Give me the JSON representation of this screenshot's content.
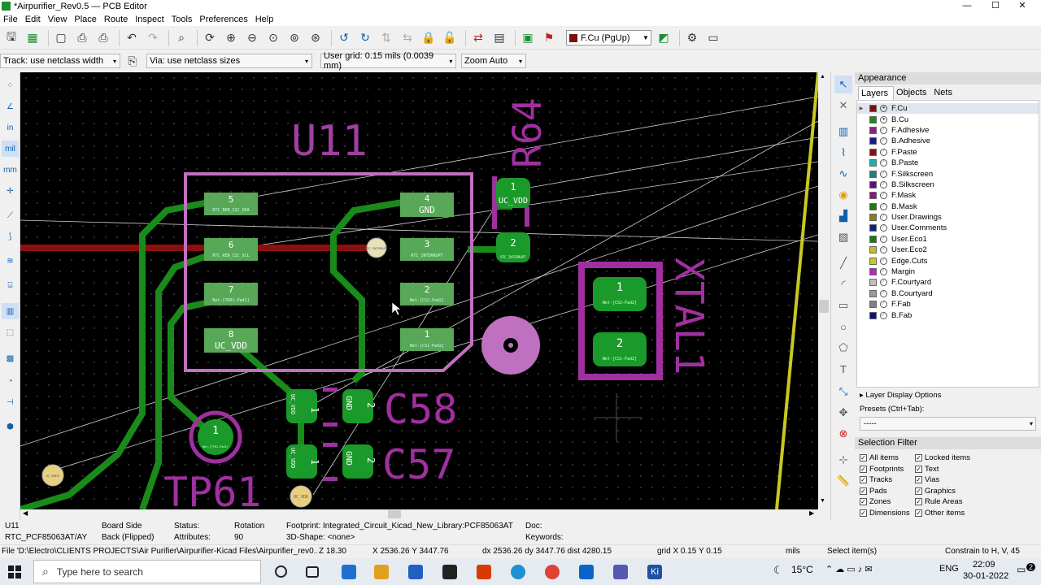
{
  "window": {
    "title": "*Airpurifier_Rev0.5 — PCB Editor",
    "minimize": "—",
    "maximize": "☐",
    "close": "✕"
  },
  "menu": [
    "File",
    "Edit",
    "View",
    "Place",
    "Route",
    "Inspect",
    "Tools",
    "Preferences",
    "Help"
  ],
  "toolbar": {
    "layer_selector": "F.Cu (PgUp)",
    "layer_color": "#7a1010"
  },
  "options": {
    "track": "Track: use netclass width",
    "via": "Via: use netclass sizes",
    "grid": "User grid: 0.15 mils (0.0039 mm)",
    "zoom": "Zoom Auto"
  },
  "canvas": {
    "u11_ref": "U11",
    "r64_ref": "R64",
    "xtal1_ref": "XTAL1",
    "c58_ref": "C58",
    "c57_ref": "C57",
    "tp61_ref": "TP61",
    "u11_pads": [
      {
        "num": "5",
        "net": "RTC_REN_I2C_SDA"
      },
      {
        "num": "6",
        "net": "RTC_REN_I2C_SCL"
      },
      {
        "num": "7",
        "net": "Net-[TR01-Pad1]"
      },
      {
        "num": "8",
        "net": "UC_VDD"
      },
      {
        "num": "4",
        "net": "GND"
      },
      {
        "num": "3",
        "net": "RTC_INTERRUPT"
      },
      {
        "num": "2",
        "net": "Net-[CS2-Pad2]"
      },
      {
        "num": "1",
        "net": "Net-[CS1-Pad2]"
      }
    ],
    "r64_pads": [
      {
        "num": "1",
        "net": "UC_VDD"
      },
      {
        "num": "2",
        "net": "RTC_INTERRUPT"
      }
    ],
    "xtal_pads": [
      {
        "num": "1",
        "net": "Net-[CS2-Pad2]"
      },
      {
        "num": "2",
        "net": "Net-[CS1-Pad2]"
      }
    ],
    "c58_pads": [
      {
        "num": "1",
        "net": "UC_VDD"
      },
      {
        "num": "2",
        "net": "GND"
      }
    ],
    "c57_pads": [
      {
        "num": "1",
        "net": "UC_VDD"
      },
      {
        "num": "2",
        "net": "GND"
      }
    ],
    "tp61_pad": {
      "num": "1",
      "net": "Net-[TP61-Pad1]"
    },
    "via_labels": [
      "RTC_INTERRUPT",
      "UC_SENSE",
      "UC_VDD"
    ]
  },
  "appearance": {
    "title": "Appearance",
    "tabs": [
      "Layers",
      "Objects",
      "Nets"
    ],
    "layers": [
      {
        "name": "F.Cu",
        "color": "#7a1010"
      },
      {
        "name": "B.Cu",
        "color": "#1a8a1a"
      },
      {
        "name": "F.Adhesive",
        "color": "#8a2080"
      },
      {
        "name": "B.Adhesive",
        "color": "#1a1a90"
      },
      {
        "name": "F.Paste",
        "color": "#8a1010"
      },
      {
        "name": "B.Paste",
        "color": "#20b0b0"
      },
      {
        "name": "F.Silkscreen",
        "color": "#208080"
      },
      {
        "name": "B.Silkscreen",
        "color": "#5a1080"
      },
      {
        "name": "F.Mask",
        "color": "#8a1880"
      },
      {
        "name": "B.Mask",
        "color": "#1a7a1a"
      },
      {
        "name": "User.Drawings",
        "color": "#808020"
      },
      {
        "name": "User.Comments",
        "color": "#102080"
      },
      {
        "name": "User.Eco1",
        "color": "#108010"
      },
      {
        "name": "User.Eco2",
        "color": "#c0c020"
      },
      {
        "name": "Edge.Cuts",
        "color": "#c8c820"
      },
      {
        "name": "Margin",
        "color": "#c020c0"
      },
      {
        "name": "F.Courtyard",
        "color": "#c0c0c0"
      },
      {
        "name": "B.Courtyard",
        "color": "#9a9a9a"
      },
      {
        "name": "F.Fab",
        "color": "#808080"
      },
      {
        "name": "B.Fab",
        "color": "#101080"
      }
    ],
    "display_options": "Layer Display Options",
    "presets_label": "Presets (Ctrl+Tab):",
    "presets_value": "-----"
  },
  "selection_filter": {
    "title": "Selection Filter",
    "items": [
      {
        "label": "All items",
        "checked": true
      },
      {
        "label": "Locked items",
        "checked": true
      },
      {
        "label": "Footprints",
        "checked": true
      },
      {
        "label": "Text",
        "checked": true
      },
      {
        "label": "Tracks",
        "checked": true
      },
      {
        "label": "Vias",
        "checked": true
      },
      {
        "label": "Pads",
        "checked": true
      },
      {
        "label": "Graphics",
        "checked": true
      },
      {
        "label": "Zones",
        "checked": true
      },
      {
        "label": "Rule Areas",
        "checked": true
      },
      {
        "label": "Dimensions",
        "checked": true
      },
      {
        "label": "Other items",
        "checked": true
      }
    ]
  },
  "info": {
    "ref": "U11",
    "value": "RTC_PCF85063AT/AY",
    "board_side_label": "Board Side",
    "board_side": "Back (Flipped)",
    "status_label": "Status:",
    "attributes_label": "Attributes:",
    "rotation_label": "Rotation",
    "rotation": "90",
    "footprint": "Footprint: Integrated_Circuit_Kicad_New_Library:PCF85063AT",
    "shape": "3D-Shape: <none>",
    "doc": "Doc:",
    "keywords": "Keywords:"
  },
  "status": {
    "file": "File 'D:\\Electro\\CLIENTS PROJECTS\\Air Purifier\\Airpurifier-Kicad Files\\Airpurifier_rev0...",
    "z": "Z 18.30",
    "xy": "X 2536.26  Y 3447.76",
    "dxy": "dx 2536.26  dy 3447.76  dist 4280.15",
    "grid": "grid X 0.15  Y 0.15",
    "units": "mils",
    "selected": "Select item(s)",
    "constrain": "Constrain to H, V, 45"
  },
  "taskbar": {
    "search": "Type here to search",
    "temp": "15°C",
    "lang": "ENG",
    "time": "22:09",
    "date": "30-01-2022",
    "notif": "2"
  }
}
